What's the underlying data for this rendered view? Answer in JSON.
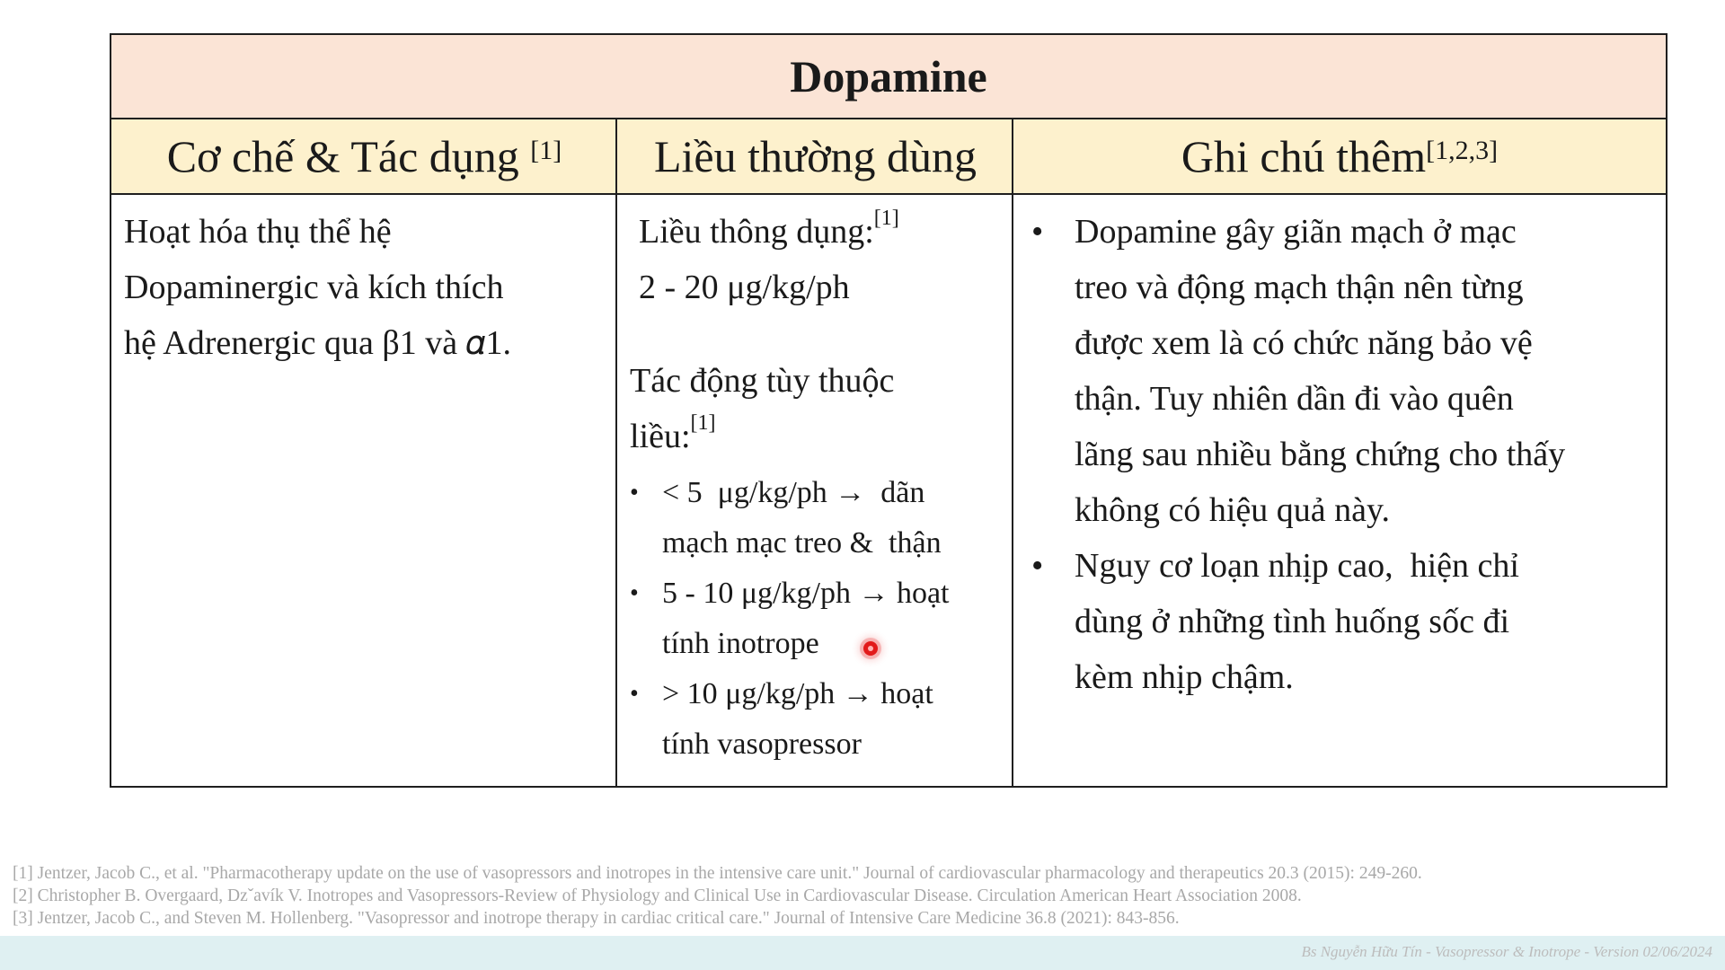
{
  "table": {
    "title": "Dopamine",
    "headers": {
      "mechanism": "Cơ chế & Tác dụng ",
      "mechanism_ref": "[1]",
      "dose": "Liều thường dùng",
      "notes": "Ghi chú thêm",
      "notes_ref": "[1,2,3]"
    },
    "mechanism": {
      "lines": [
        "Hoạt hóa thụ thể hệ",
        "Dopaminergic và kích thích",
        "hệ Adrenergic qua β1 và 𝛼1."
      ]
    },
    "dose": {
      "common_label": "Liều thông dụng:",
      "common_ref": "[1]",
      "common_value": "2 - 20 μg/kg/ph",
      "effect_label_1": "Tác động tùy thuộc",
      "effect_label_2": "liều:",
      "effect_ref": "[1]",
      "effects": [
        {
          "line1": "< 5  μg/kg/ph →  dãn",
          "line2": "mạch mạc treo &  thận"
        },
        {
          "line1": "5 - 10 μg/kg/ph → hoạt",
          "line2": "tính inotrope"
        },
        {
          "line1": "> 10 μg/kg/ph → hoạt",
          "line2": "tính vasopressor"
        }
      ]
    },
    "notes": [
      {
        "lines": [
          "Dopamine gây giãn mạch ở mạc",
          "treo và động mạch thận nên từng",
          "được xem là có chức năng bảo vệ",
          "thận. Tuy nhiên dần đi vào quên",
          "lãng sau nhiều bằng chứng cho thấy",
          "không có hiệu quả này."
        ]
      },
      {
        "lines": [
          "Nguy cơ loạn nhịp cao,  hiện chỉ",
          "dùng ở những tình huống sốc đi",
          "kèm nhịp chậm."
        ]
      }
    ]
  },
  "references": [
    "[1] Jentzer, Jacob C., et al. \"Pharmacotherapy update on the use of vasopressors and inotropes in the intensive care unit.\" Journal of cardiovascular pharmacology and therapeutics 20.3 (2015): 249-260.",
    "[2] Christopher B. Overgaard, Dzˇavík V. Inotropes and Vasopressors-Review of Physiology and Clinical Use in Cardiovascular Disease. Circulation American Heart Association 2008.",
    "[3] Jentzer, Jacob C., and Steven M. Hollenberg. \"Vasopressor and inotrope therapy in cardiac critical care.\" Journal of Intensive Care Medicine 36.8 (2021): 843-856."
  ],
  "footer": {
    "text": "Bs Nguyễn Hữu Tín - Vasopressor & Inotrope - Version 02/06/2024"
  },
  "colors": {
    "title_bg": "#fbe4d6",
    "header_bg": "#fdf1cd",
    "border": "#1f1f1f",
    "footer_band": "#dff0f2",
    "pointer": "#e21a1a"
  }
}
